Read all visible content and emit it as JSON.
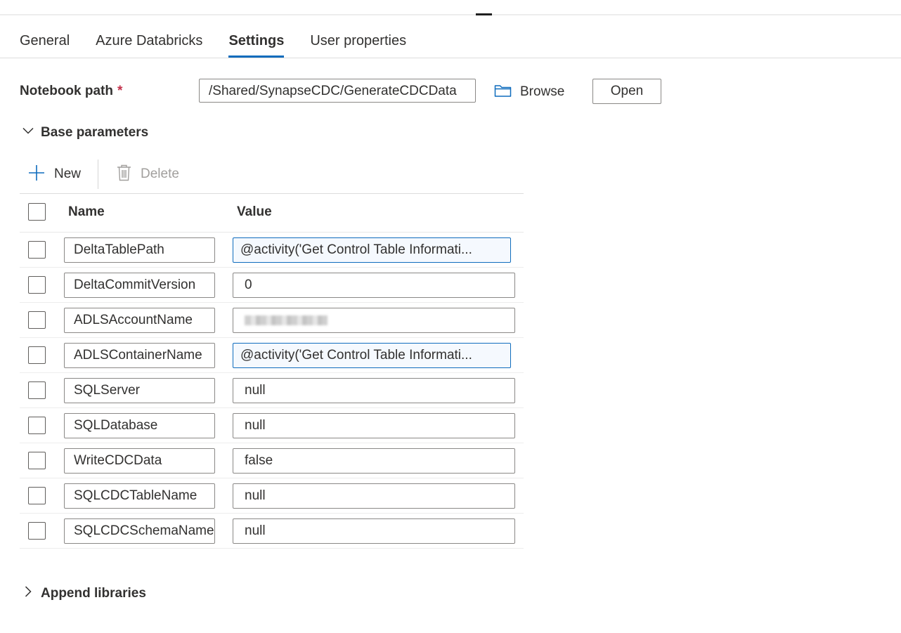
{
  "tabs": [
    {
      "label": "General"
    },
    {
      "label": "Azure Databricks"
    },
    {
      "label": "Settings"
    },
    {
      "label": "User properties"
    }
  ],
  "active_tab": "Settings",
  "notebook": {
    "label": "Notebook path",
    "required_mark": "*",
    "value": "/Shared/SynapseCDC/GenerateCDCData",
    "browse_label": "Browse",
    "open_label": "Open"
  },
  "base_parameters": {
    "title": "Base parameters",
    "expanded": true,
    "new_label": "New",
    "delete_label": "Delete",
    "columns": {
      "name": "Name",
      "value": "Value"
    },
    "rows": [
      {
        "name": "DeltaTablePath",
        "value": "@activity('Get Control Table Informati...",
        "is_expression": true
      },
      {
        "name": "DeltaCommitVersion",
        "value": "0",
        "is_expression": false
      },
      {
        "name": "ADLSAccountName",
        "value": "",
        "is_expression": false,
        "redacted": true
      },
      {
        "name": "ADLSContainerName",
        "value": "@activity('Get Control Table Informati...",
        "is_expression": true
      },
      {
        "name": "SQLServer",
        "value": "null",
        "is_expression": false
      },
      {
        "name": "SQLDatabase",
        "value": "null",
        "is_expression": false
      },
      {
        "name": "WriteCDCData",
        "value": "false",
        "is_expression": false
      },
      {
        "name": "SQLCDCTableName",
        "value": "null",
        "is_expression": false
      },
      {
        "name": "SQLCDCSchemaName",
        "value": "null",
        "is_expression": false
      }
    ]
  },
  "append_libraries": {
    "title": "Append libraries",
    "expanded": false
  },
  "colors": {
    "accent": "#0f6cbd",
    "text": "#323130",
    "disabled_text": "#a19f9d",
    "required": "#c4314b",
    "expression_bg": "#f5f9fe"
  },
  "icons": {
    "new": "plus-icon",
    "delete": "trash-icon",
    "browse": "folder-icon",
    "base_parameters": "chevron-down-icon",
    "append_libraries": "chevron-right-icon"
  }
}
